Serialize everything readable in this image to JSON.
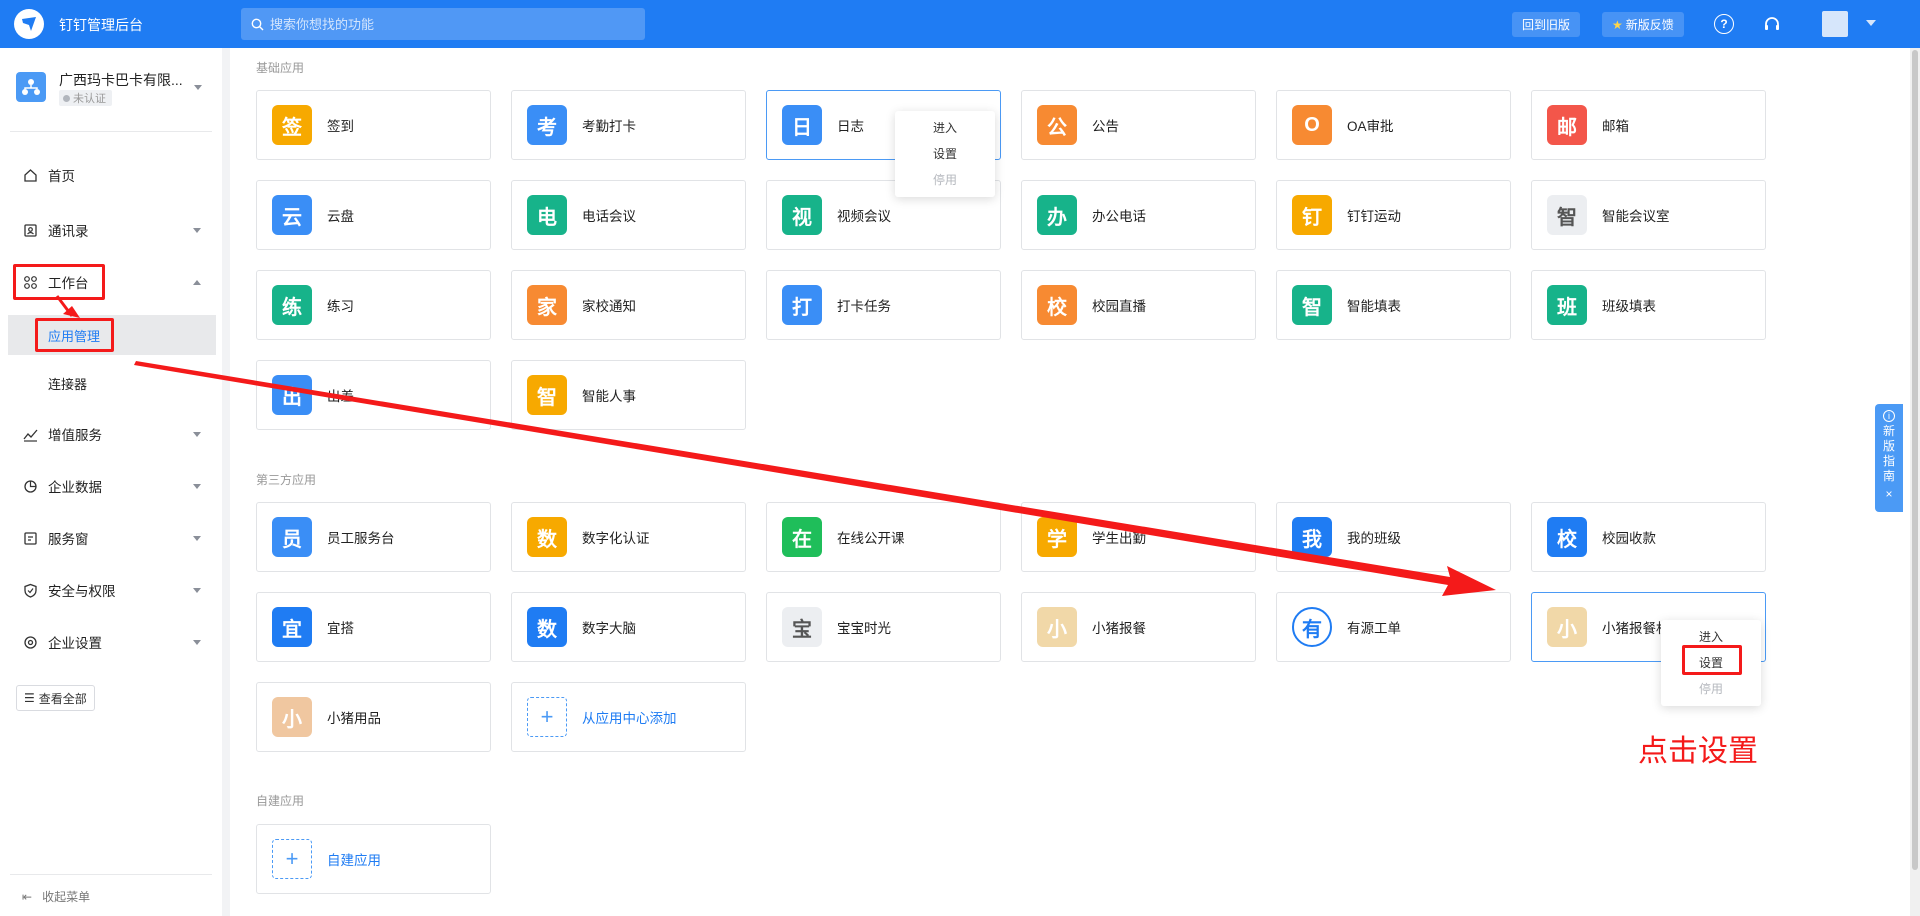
{
  "topbar": {
    "title": "钉钉管理后台",
    "search_placeholder": "搜索你想找的功能",
    "back_old": "回到旧版",
    "feedback": "新版反馈",
    "help_icon": "question-circle-icon",
    "service_icon": "headset-icon"
  },
  "sidebar": {
    "org_name": "广西玛卡巴卡有限...",
    "org_status": "未认证",
    "items": {
      "home": "首页",
      "contacts": "通讯录",
      "workbench": "工作台",
      "app_manage": "应用管理",
      "connector": "连接器",
      "value_added": "增值服务",
      "enterprise_data": "企业数据",
      "service_window": "服务窗",
      "security": "安全与权限",
      "settings": "企业设置"
    },
    "view_all": "查看全部",
    "collapse": "收起菜单"
  },
  "sections": {
    "basic": "基础应用",
    "third_party": "第三方应用",
    "self_built": "自建应用"
  },
  "basic_apps": [
    {
      "label": "签到",
      "color": "#f7a900"
    },
    {
      "label": "考勤打卡",
      "color": "#3a8ef6"
    },
    {
      "label": "日志",
      "color": "#3a8ef6"
    },
    {
      "label": "公告",
      "color": "#f78a32"
    },
    {
      "label": "OA审批",
      "color": "#f78a32"
    },
    {
      "label": "邮箱",
      "color": "#f3564a"
    },
    {
      "label": "云盘",
      "color": "#3a8ef6"
    },
    {
      "label": "电话会议",
      "color": "#17b38a"
    },
    {
      "label": "视频会议",
      "color": "#17b38a"
    },
    {
      "label": "办公电话",
      "color": "#17b38a"
    },
    {
      "label": "钉钉运动",
      "color": "#f7a900"
    },
    {
      "label": "智能会议室",
      "color": "#eceef1"
    },
    {
      "label": "练习",
      "color": "#17b38a"
    },
    {
      "label": "家校通知",
      "color": "#f78a32"
    },
    {
      "label": "打卡任务",
      "color": "#3a8ef6"
    },
    {
      "label": "校园直播",
      "color": "#f78a32"
    },
    {
      "label": "智能填表",
      "color": "#17b38a"
    },
    {
      "label": "班级填表",
      "color": "#17b38a"
    },
    {
      "label": "出差",
      "color": "#3a8ef6"
    },
    {
      "label": "智能人事",
      "color": "#f7a900"
    }
  ],
  "third_apps": [
    {
      "label": "员工服务台",
      "color": "#3a8ef6"
    },
    {
      "label": "数字化认证",
      "color": "#f7a900"
    },
    {
      "label": "在线公开课",
      "color": "#1fbe5a"
    },
    {
      "label": "学生出勤",
      "color": "#f7a900"
    },
    {
      "label": "我的班级",
      "color": "#1f7cf3"
    },
    {
      "label": "校园收款",
      "color": "#1f7cf3"
    },
    {
      "label": "宜搭",
      "color": "#1f7cf3"
    },
    {
      "label": "数字大脑",
      "color": "#1f7cf3"
    },
    {
      "label": "宝宝时光",
      "color": "#eceef1"
    },
    {
      "label": "小猪报餐",
      "color": "#f1d8a8"
    },
    {
      "label": "有源工单",
      "color": "#ffffff"
    },
    {
      "label": "小猪报餐机",
      "color": "#f1d8a8"
    },
    {
      "label": "小猪用品",
      "color": "#f0c7a0"
    }
  ],
  "add_from_center": "从应用中心添加",
  "self_built_add": "自建应用",
  "menu1": {
    "enter": "进入",
    "settings": "设置",
    "disable": "停用"
  },
  "menu2": {
    "enter": "进入",
    "settings": "设置",
    "disable": "停用"
  },
  "guide": {
    "text": "新版指南",
    "close": "×"
  },
  "annotation": "点击设置"
}
